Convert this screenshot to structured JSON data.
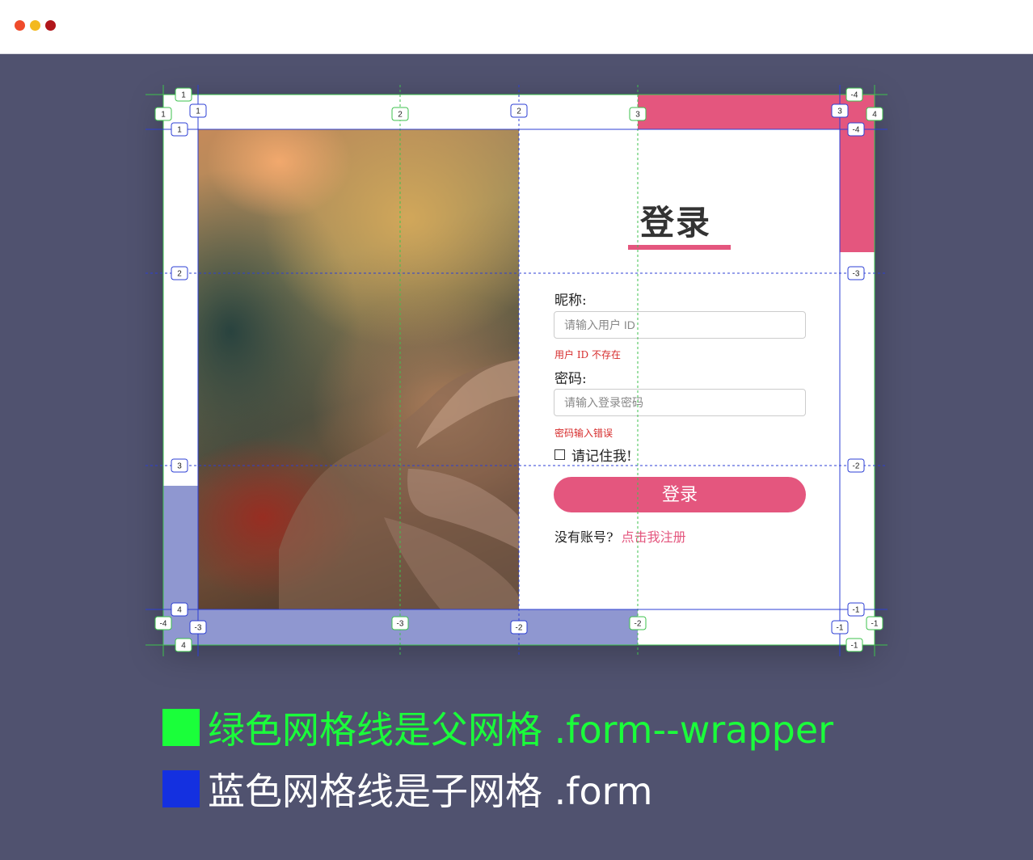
{
  "window": {
    "controls": [
      "close",
      "minimize",
      "maximize"
    ]
  },
  "form": {
    "heading": "登录",
    "nickname_label": "昵称:",
    "nickname_placeholder": "请输入用户 ID",
    "nickname_error": "用户 ID 不存在",
    "password_label": "密码:",
    "password_placeholder": "请输入登录密码",
    "password_error": "密码输入错误",
    "remember_label": "请记住我!",
    "login_button": "登录",
    "signup_prompt": "没有账号?",
    "signup_link": "点击我注册"
  },
  "grid_labels": {
    "green_top": [
      "1",
      "2",
      "3",
      "4"
    ],
    "green_bottom": [
      "-4",
      "-3",
      "-2",
      "-1"
    ],
    "green_left": [
      "1",
      "4"
    ],
    "green_right": [
      "-4",
      "-1"
    ],
    "blue_top": [
      "1",
      "2",
      "3"
    ],
    "blue_bottom": [
      "-3",
      "-2",
      "-1"
    ],
    "blue_left": [
      "1",
      "2",
      "3",
      "4"
    ],
    "blue_right": [
      "-4",
      "-3",
      "-2",
      "-1"
    ]
  },
  "legend": {
    "green_text": "绿色网格线是父网格 .form--wrapper",
    "blue_text": "蓝色网格线是子网格 .form"
  },
  "colors": {
    "accent_pink": "#e4567e",
    "green_grid": "#1aff3a",
    "blue_grid": "#1430e0",
    "stage_bg": "#50526f"
  }
}
